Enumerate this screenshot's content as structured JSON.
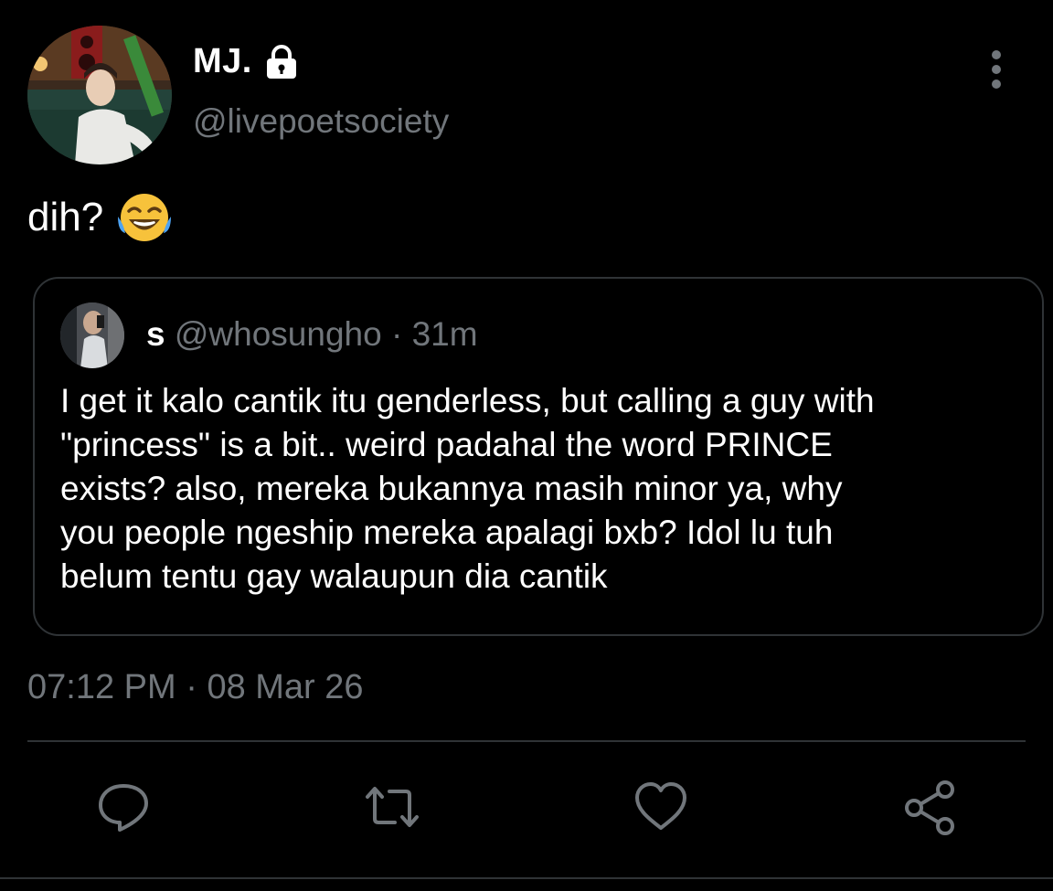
{
  "author": {
    "display_name": "MJ.",
    "handle": "@livepoetsociety",
    "verified_icon": "lock-icon"
  },
  "tweet": {
    "text": "dih?",
    "emoji": "face-with-tears-of-joy-icon",
    "timestamp": "07:12 PM",
    "separator": "·",
    "date": "08 Mar 26"
  },
  "quote": {
    "display_name": "s",
    "handle": "@whosungho",
    "separator": "·",
    "time": "31m",
    "text": "I get it kalo cantik itu genderless, but calling a guy with\n\"princess\" is a bit.. weird padahal the word PRINCE\nexists? also, mereka bukannya masih minor ya, why\nyou people ngeship mereka apalagi bxb? Idol lu tuh\nbelum tentu gay walaupun dia cantik"
  },
  "actions": [
    "reply-icon",
    "retweet-icon",
    "like-icon",
    "share-icon"
  ],
  "colors": {
    "background": "#000000",
    "text_primary": "#ffffff",
    "text_secondary": "#71767b",
    "border": "#2f3336"
  }
}
